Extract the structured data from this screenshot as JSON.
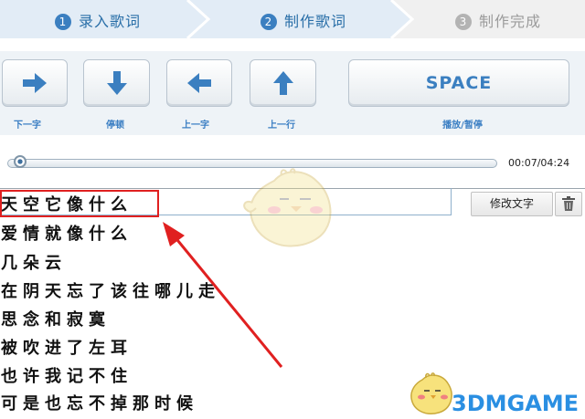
{
  "steps": [
    {
      "num": "1",
      "label": "录入歌词",
      "state": "done"
    },
    {
      "num": "2",
      "label": "制作歌词",
      "state": "active"
    },
    {
      "num": "3",
      "label": "制作完成",
      "state": "pending"
    }
  ],
  "keys": [
    {
      "icon": "arrow-right-icon",
      "label": "下一字"
    },
    {
      "icon": "arrow-down-icon",
      "label": "停顿"
    },
    {
      "icon": "arrow-left-icon",
      "label": "上一字"
    },
    {
      "icon": "arrow-up-icon",
      "label": "上一行"
    },
    {
      "icon": "space-key",
      "text": "SPACE",
      "label": "播放/暂停"
    }
  ],
  "player": {
    "time": "00:07/04:24",
    "progress": 0.026
  },
  "lyrics": [
    "天空它像什么",
    "爱情就像什么",
    "几朵云",
    "在阴天忘了该往哪儿走",
    "思念和寂寞",
    "被吹进了左耳",
    "也许我记不住",
    "可是也忘不掉那时候"
  ],
  "actions": {
    "modify_label": "修改文字",
    "delete_icon": "trash-icon"
  },
  "watermark": "3DMGAME",
  "colors": {
    "accent": "#3b7fc0",
    "highlight": "#e02020"
  }
}
